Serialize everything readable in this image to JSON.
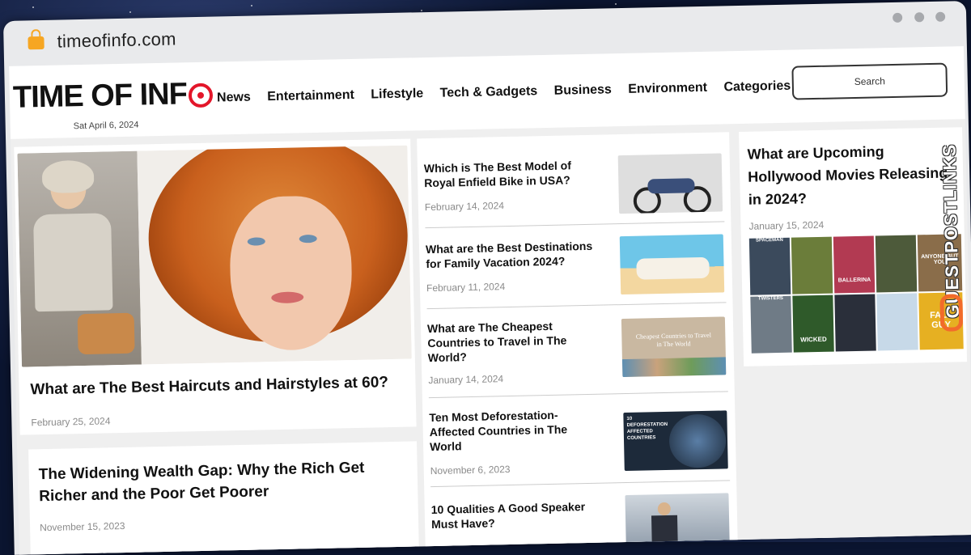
{
  "browser": {
    "url": "timeofinfo.com"
  },
  "site": {
    "logo": "TIME OF INF",
    "date": "Sat April 6, 2024",
    "nav": [
      "News",
      "Entertainment",
      "Lifestyle",
      "Tech & Gadgets",
      "Business",
      "Environment",
      "Categories"
    ],
    "search_label": "Search"
  },
  "featured": {
    "title": "What are The Best Haircuts and Hairstyles at 60?",
    "date": "February 25, 2024"
  },
  "second": {
    "title": "The Widening Wealth Gap: Why the Rich Get Richer and the Poor Get Poorer",
    "date": "November 15, 2023"
  },
  "list": [
    {
      "title": "Which is The Best Model of Royal Enfield Bike in USA?",
      "date": "February 14, 2024"
    },
    {
      "title": "What are the Best Destinations for Family Vacation 2024?",
      "date": "February 11, 2024"
    },
    {
      "title": "What are The Cheapest Countries to Travel in The World?",
      "date": "January 14, 2024",
      "thumb_text": "Cheapest Countries to Travel in The World"
    },
    {
      "title": "Ten Most Deforestation-Affected Countries in The World",
      "date": "November 6, 2023",
      "thumb_text": "10 DEFORESTATION AFFECTED COUNTRIES"
    },
    {
      "title": "10 Qualities A Good Speaker Must Have?",
      "date": ""
    }
  ],
  "right": {
    "title": "What are Upcoming Hollywood Movies Releasing in 2024?",
    "date": "January 15, 2024",
    "posters": [
      "SPACEMAN",
      "",
      "BALLERINA",
      "",
      "ANYONE BUT YOU",
      "TWISTERS",
      "WICKED",
      "",
      "",
      "FALL GUY"
    ]
  },
  "watermark": "GUESTPOSTLINKS",
  "colors": {
    "brand_red": "#e3162a",
    "lock": "#f6a623",
    "watermark_accent": "#f26b2b"
  }
}
